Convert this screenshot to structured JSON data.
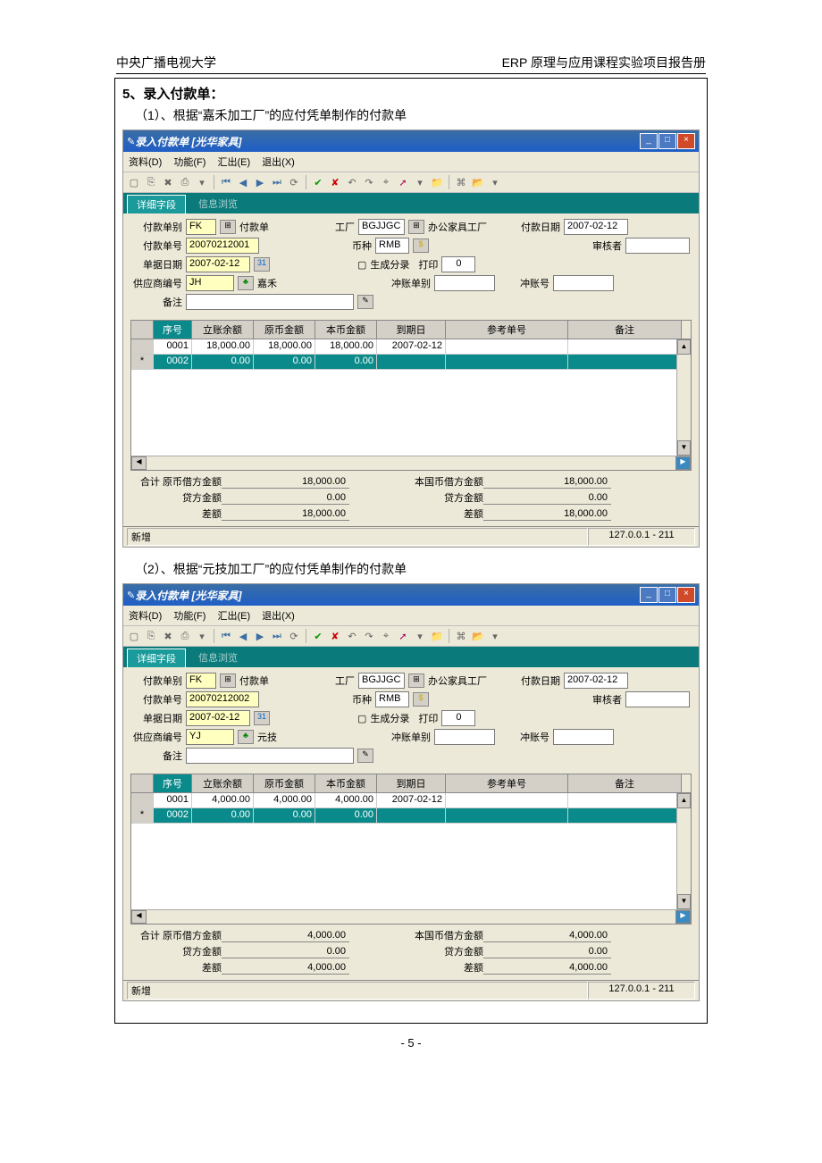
{
  "hdr": {
    "left": "中央广播电视大学",
    "right": "ERP 原理与应用课程实验项目报告册"
  },
  "sec5": "5、录入付款单：",
  "sub1": "（1）、根据“嘉禾加工厂”的应付凭单制作的付款单",
  "sub2": "（2）、根据“元技加工厂”的应付凭单制作的付款单",
  "menus": {
    "d": "资料(D)",
    "f": "功能(F)",
    "e": "汇出(E)",
    "x": "退出(X)"
  },
  "tabs": {
    "detail": "详细字段",
    "info": "信息浏览"
  },
  "labels": {
    "type": "付款单别",
    "typeName": "付款单",
    "factory": "工厂",
    "factoryName": "办公家具工厂",
    "payDate": "付款日期",
    "no": "付款单号",
    "currency": "币种",
    "auditor": "审核者",
    "docDate": "单据日期",
    "gen": "生成分录",
    "print": "打印",
    "supplier": "供应商编号",
    "offsetType": "冲账单别",
    "offsetNo": "冲账号",
    "remark": "备注"
  },
  "cols": {
    "seq": "序号",
    "bal": "立账余额",
    "orig": "原币金额",
    "base": "本币金额",
    "due": "到期日",
    "ref": "参考单号",
    "note": "备注"
  },
  "totals": {
    "t1": "合计 原币借方金额",
    "t2": "贷方金额",
    "t3": "差额",
    "t4": "本国币借方金额",
    "t5": "贷方金额",
    "t6": "差额"
  },
  "status": {
    "mode": "新增",
    "ip": "127.0.0.1 - 211"
  },
  "pagenum": "- 5 -",
  "win1": {
    "title": "录入付款单 [光华家具]",
    "f": {
      "type": "FK",
      "factory": "BGJJGC",
      "payDate": "2007-02-12",
      "no": "20070212001",
      "currency": "RMB",
      "docDate": "2007-02-12",
      "printCnt": "0",
      "supplier": "JH",
      "supplierName": "嘉禾"
    },
    "rows": [
      {
        "seq": "0001",
        "bal": "18,000.00",
        "orig": "18,000.00",
        "base": "18,000.00",
        "due": "2007-02-12",
        "ref": "",
        "note": ""
      },
      {
        "seq": "0002",
        "bal": "0.00",
        "orig": "0.00",
        "base": "0.00",
        "due": "",
        "ref": "",
        "note": ""
      }
    ],
    "tot": {
      "v1": "18,000.00",
      "v2": "0.00",
      "v3": "18,000.00",
      "v4": "18,000.00",
      "v5": "0.00",
      "v6": "18,000.00"
    }
  },
  "win2": {
    "title": "录入付款单 [光华家具]",
    "f": {
      "type": "FK",
      "factory": "BGJJGC",
      "payDate": "2007-02-12",
      "no": "20070212002",
      "currency": "RMB",
      "docDate": "2007-02-12",
      "printCnt": "0",
      "supplier": "YJ",
      "supplierName": "元技"
    },
    "rows": [
      {
        "seq": "0001",
        "bal": "4,000.00",
        "orig": "4,000.00",
        "base": "4,000.00",
        "due": "2007-02-12",
        "ref": "",
        "note": ""
      },
      {
        "seq": "0002",
        "bal": "0.00",
        "orig": "0.00",
        "base": "0.00",
        "due": "",
        "ref": "",
        "note": ""
      }
    ],
    "tot": {
      "v1": "4,000.00",
      "v2": "0.00",
      "v3": "4,000.00",
      "v4": "4,000.00",
      "v5": "0.00",
      "v6": "4,000.00"
    }
  }
}
